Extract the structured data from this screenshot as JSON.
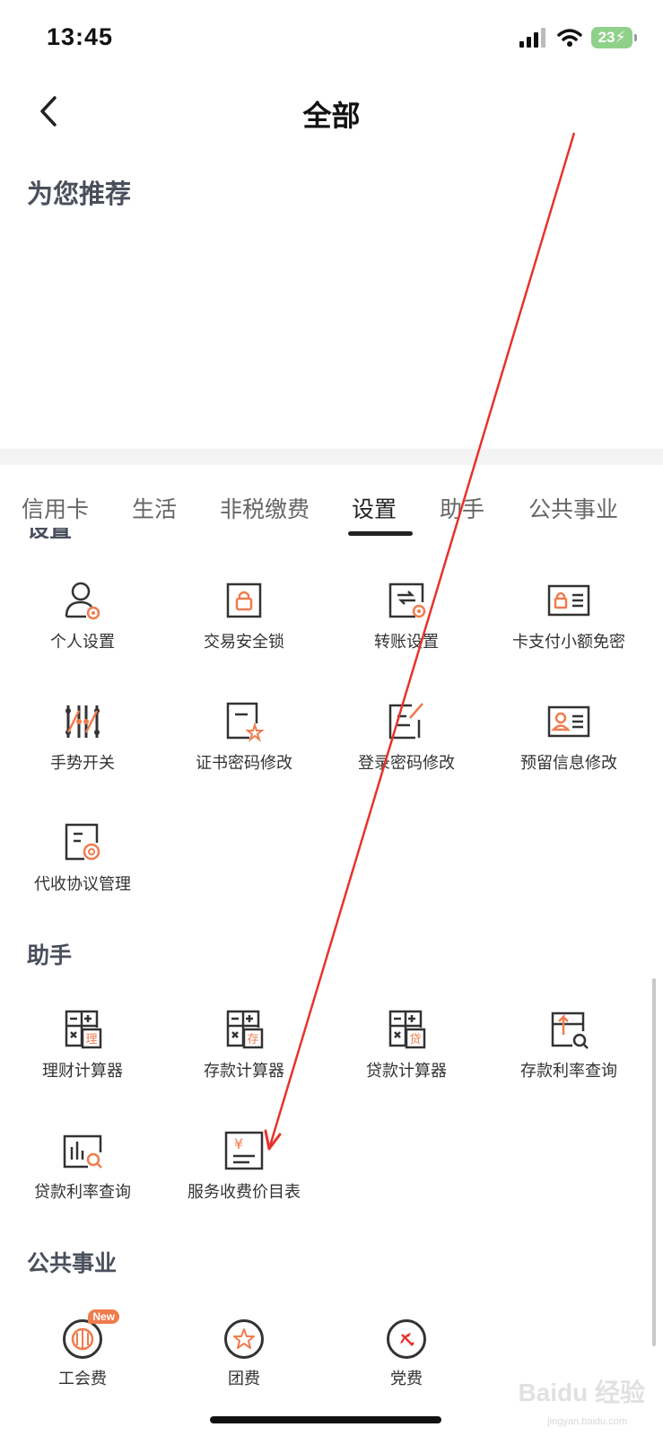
{
  "status_bar": {
    "time": "13:45",
    "battery": "23"
  },
  "nav": {
    "title": "全部"
  },
  "recommend": {
    "title": "为您推荐"
  },
  "tabs": [
    {
      "label": "信用卡"
    },
    {
      "label": "生活"
    },
    {
      "label": "非税缴费"
    },
    {
      "label": "设置",
      "active": true
    },
    {
      "label": "助手"
    },
    {
      "label": "公共事业"
    }
  ],
  "settings": {
    "title": "设置",
    "items": [
      {
        "label": "个人设置",
        "icon": "person-gear-icon"
      },
      {
        "label": "交易安全锁",
        "icon": "lock-icon"
      },
      {
        "label": "转账设置",
        "icon": "transfer-settings-icon"
      },
      {
        "label": "卡支付小额免密",
        "icon": "card-lock-icon"
      },
      {
        "label": "手势开关",
        "icon": "gesture-icon"
      },
      {
        "label": "证书密码修改",
        "icon": "certificate-icon"
      },
      {
        "label": "登录密码修改",
        "icon": "login-password-icon"
      },
      {
        "label": "预留信息修改",
        "icon": "id-card-icon"
      },
      {
        "label": "代收协议管理",
        "icon": "agreement-gear-icon"
      }
    ]
  },
  "assistant": {
    "title": "助手",
    "items": [
      {
        "label": "理财计算器",
        "icon": "calculator-icon",
        "tag": "理"
      },
      {
        "label": "存款计算器",
        "icon": "calculator-icon",
        "tag": "存"
      },
      {
        "label": "贷款计算器",
        "icon": "calculator-icon",
        "tag": "贷"
      },
      {
        "label": "存款利率查询",
        "icon": "deposit-rate-icon"
      },
      {
        "label": "贷款利率查询",
        "icon": "loan-rate-chart-icon"
      },
      {
        "label": "服务收费价目表",
        "icon": "fee-list-icon",
        "symbol": "¥"
      }
    ]
  },
  "public": {
    "title": "公共事业",
    "items": [
      {
        "label": "工会费",
        "icon": "union-icon",
        "badge": "New"
      },
      {
        "label": "团费",
        "icon": "star-icon"
      },
      {
        "label": "党费",
        "icon": "party-icon"
      }
    ]
  },
  "watermark": {
    "text": "Baidu 经验",
    "sub": "jingyan.baidu.com"
  },
  "colors": {
    "accent": "#f07c4e",
    "icon": "#333333",
    "arrow": "#e8322b"
  }
}
